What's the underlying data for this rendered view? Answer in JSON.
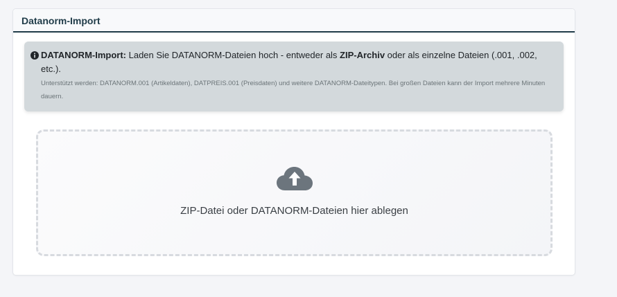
{
  "card": {
    "title": "Datanorm-Import"
  },
  "alert": {
    "icon": "info-circle-icon",
    "lead_bold": "DATANORM-Import:",
    "text_part1": " Laden Sie DATANORM-Dateien hoch - entweder als ",
    "bold_zip": "ZIP-Archiv",
    "text_part2": " oder als einzelne Dateien (.001, .002, etc.).",
    "subtext": "Unterstützt werden: DATANORM.001 (Artikeldaten), DATPREIS.001 (Preisdaten) und weitere DATANORM-Dateitypen. Bei großen Dateien kann der Import mehrere Minuten dauern."
  },
  "dropzone": {
    "icon": "cloud-upload-icon",
    "label": "ZIP-Datei oder DATANORM-Dateien hier ablegen"
  },
  "colors": {
    "header_accent": "#1f3b48",
    "alert_bg": "#d3d9dc",
    "icon_gray": "#6c757d"
  }
}
